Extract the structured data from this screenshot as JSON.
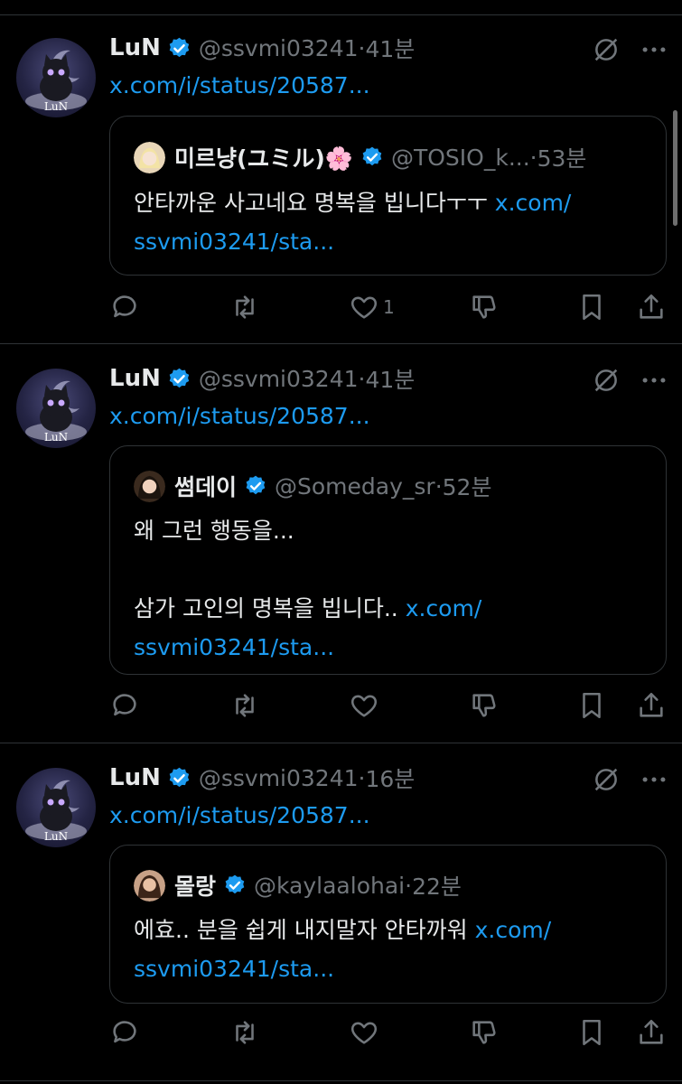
{
  "tweets": [
    {
      "author": {
        "name": "LuN",
        "handle": "@ssvmi03241",
        "time": "41분",
        "avatar_text": "LuN"
      },
      "link": "x.com/i/status/20587...",
      "quote": {
        "name": "미르냥(ユミル)🌸",
        "handle": "@TOSIO_k...",
        "time": "53분",
        "text": "안타까운 사고네요 명복을 빕니다ㅜㅜ ",
        "link_part1": "x.com/",
        "link_part2": "ssvmi03241/sta..."
      },
      "actions": {
        "like_count": "1"
      }
    },
    {
      "author": {
        "name": "LuN",
        "handle": "@ssvmi03241",
        "time": "41분",
        "avatar_text": "LuN"
      },
      "link": "x.com/i/status/20587...",
      "quote": {
        "name": "썸데이",
        "handle": "@Someday_sr",
        "time": "52분",
        "text_line1": "왜 그런 행동을...",
        "text": "삼가 고인의 명복을 빕니다.. ",
        "link_part1": "x.com/",
        "link_part2": "ssvmi03241/sta..."
      },
      "actions": {
        "like_count": ""
      }
    },
    {
      "author": {
        "name": "LuN",
        "handle": "@ssvmi03241",
        "time": "16분",
        "avatar_text": "LuN"
      },
      "link": "x.com/i/status/20587...",
      "quote": {
        "name": "몰랑",
        "handle": "@kaylaalohai",
        "time": "22분",
        "text": "에효.. 분을 쉽게 내지말자 안타까워 ",
        "link_part1": "x.com/",
        "link_part2": "ssvmi03241/sta..."
      },
      "actions": {
        "like_count": ""
      }
    }
  ],
  "separator": "·",
  "icons": [
    "verified-badge-icon",
    "grok-icon",
    "more-icon",
    "reply-icon",
    "repost-icon",
    "like-icon",
    "dislike-icon",
    "bookmark-icon",
    "share-icon"
  ],
  "colors": {
    "background": "#000000",
    "link": "#1d9bf0",
    "secondary": "#71767b",
    "verified": "#1d9bf0",
    "border": "#2f3336"
  }
}
